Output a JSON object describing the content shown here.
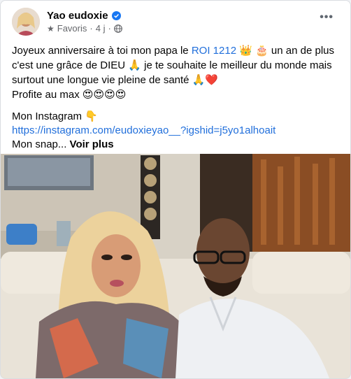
{
  "post": {
    "author": "Yao eudoxie",
    "meta_label": "Favoris",
    "meta_time": "4 j",
    "meta_sep": "·",
    "text_line1a": "Joyeux anniversaire à toi mon papa  le ",
    "text_line1_tag": "ROI 1212",
    "text_line1_emoji1": "👑",
    "text_line1_emoji2": "🎂",
    "text_line1b": " un an de plus",
    "text_line2a": "c'est une grâce de DIEU ",
    "text_line2_emoji": "🙏",
    "text_line2b": " je te souhaite le meilleur du monde mais",
    "text_line3a": "surtout une longue vie pleine de santé ",
    "text_line3_emoji": "🙏❤️",
    "text_line4a": "Profite au max ",
    "text_line4_emoji": "😍😍😍😍",
    "instagram_label": "Mon Instagram ",
    "instagram_emoji": "👇",
    "instagram_url": "https://instagram.com/eudoxieyao__?igshid=j5yo1alhoait",
    "snap_label": "Mon snap... ",
    "see_more": "Voir plus"
  },
  "colors": {
    "link": "#216fdb",
    "secondary_text": "#65676b",
    "verified": "#1877f2"
  },
  "icons": {
    "verified": "verified-badge-icon",
    "favorite": "star-icon",
    "audience": "globe-icon",
    "more": "more-options-icon"
  }
}
